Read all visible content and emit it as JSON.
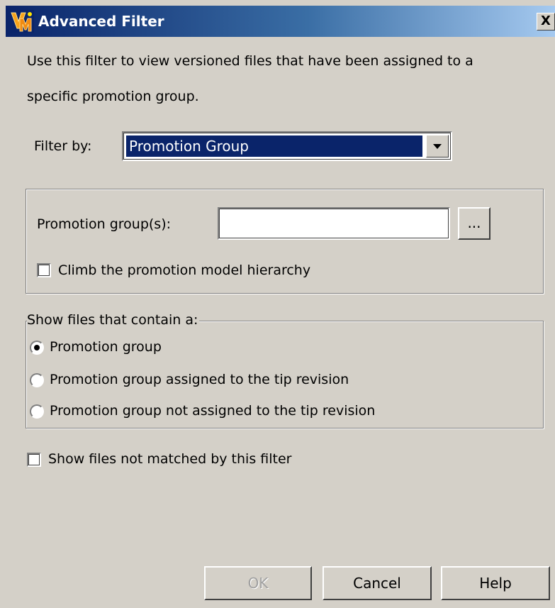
{
  "window": {
    "title": "Advanced Filter",
    "close_label": "X",
    "icon": "vm-app-icon"
  },
  "description": {
    "line1": "Use this filter to view versioned files that have been assigned to a",
    "line2": "specific promotion group."
  },
  "filter_by": {
    "label": "Filter by:",
    "selected": "Promotion Group"
  },
  "promotion_groups": {
    "label": "Promotion group(s):",
    "value": "",
    "placeholder": "",
    "browse_label": "..."
  },
  "climb_hierarchy": {
    "label": "Climb the promotion model hierarchy",
    "checked": false
  },
  "show_files_group": {
    "legend": "Show files that contain a:",
    "options": [
      {
        "label": "Promotion group",
        "checked": true
      },
      {
        "label": "Promotion group assigned to the tip revision",
        "checked": false
      },
      {
        "label": "Promotion group not assigned to the tip revision",
        "checked": false
      }
    ]
  },
  "show_unmatched": {
    "label": "Show files not matched by this filter",
    "checked": false
  },
  "buttons": {
    "ok": "OK",
    "cancel": "Cancel",
    "help": "Help"
  },
  "colors": {
    "titlebar_start": "#0a246a",
    "titlebar_end": "#a6caf0",
    "dialog_bg": "#d4d0c8",
    "selection": "#0a246a"
  }
}
